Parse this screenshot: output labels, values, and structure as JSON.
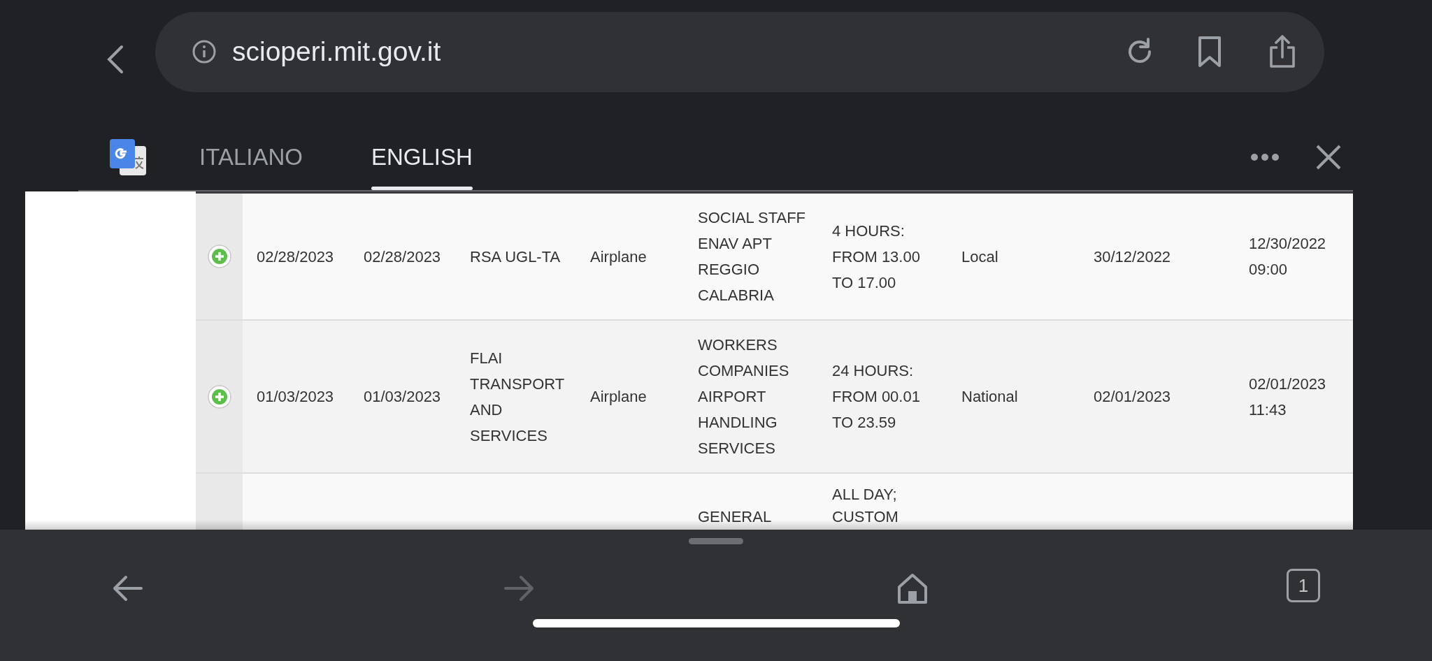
{
  "browser": {
    "url": "scioperi.mit.gov.it"
  },
  "translate_bar": {
    "tabs": [
      {
        "label": "ITALIANO",
        "selected": false
      },
      {
        "label": "ENGLISH",
        "selected": true
      }
    ]
  },
  "table": {
    "rows": [
      {
        "kind": "full",
        "cells": [
          "02/28/2023",
          "02/28/2023",
          "RSA UGL-TA",
          "Airplane",
          "SOCIAL STAFF\nENAV APT\nREGGIO\nCALABRIA",
          "4 HOURS:\nFROM 13.00\nTO 17.00",
          "Local",
          "30/12/2022",
          "12/30/2022\n09:00"
        ]
      },
      {
        "kind": "full",
        "cells": [
          "01/03/2023",
          "01/03/2023",
          "FLAI\nTRANSPORT\nAND\nSERVICES",
          "Airplane",
          "WORKERS\nCOMPANIES\nAIRPORT\nHANDLING\nSERVICES",
          "24 HOURS:\nFROM 00.01\nTO 23.59",
          "National",
          "02/01/2023",
          "02/01/2023\n11:43"
        ]
      },
      {
        "kind": "cut",
        "cells": [
          "",
          "",
          "",
          "",
          "GENERAL",
          "ALL DAY;\nCUSTOM",
          "",
          "",
          ""
        ]
      }
    ]
  },
  "toolbar": {
    "tab_count": "1"
  }
}
